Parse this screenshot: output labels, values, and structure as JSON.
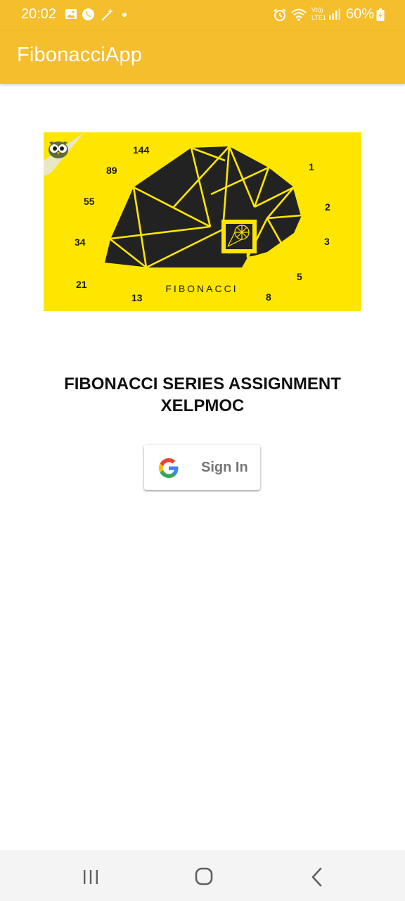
{
  "status_bar": {
    "time": "20:02",
    "battery": "60%",
    "network": "Vo)) LTE1"
  },
  "app_bar": {
    "title": "FibonacciApp",
    "background": "#F5BE2D"
  },
  "hero_image": {
    "caption": "FIBONACCI",
    "numbers": [
      "144",
      "89",
      "55",
      "34",
      "21",
      "13",
      "8",
      "5",
      "3",
      "2",
      "1"
    ],
    "background": "#FFE600",
    "shape_color": "#222222",
    "line_color": "#FFE600"
  },
  "headline": {
    "line1": "FIBONACCI SERIES ASSIGNMENT",
    "line2": "XELPMOC"
  },
  "signin": {
    "label": "Sign In",
    "icon": "google-logo-icon"
  },
  "nav": {
    "recents_icon": "recents-icon",
    "home_icon": "home-icon",
    "back_icon": "back-icon"
  }
}
